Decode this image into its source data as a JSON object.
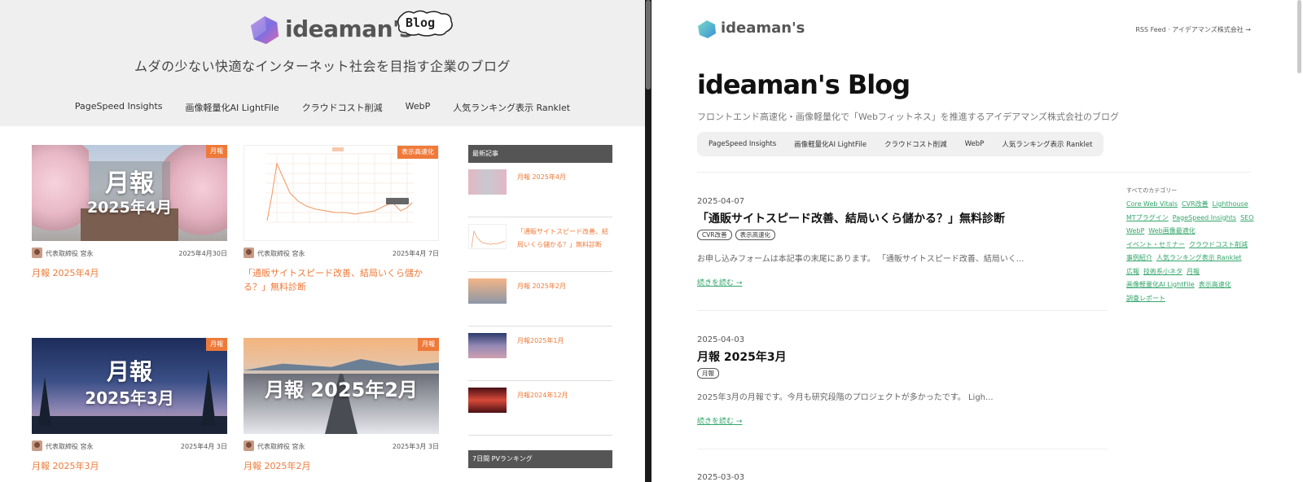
{
  "left": {
    "logo_text": "ideaman's",
    "logo_badge": "Blog",
    "tagline": "ムダの少ない快適なインターネット社会を目指す企業のブログ",
    "nav": [
      "PageSpeed Insights",
      "画像軽量化AI LightFile",
      "クラウドコスト削減",
      "WebP",
      "人気ランキング表示 Ranklet"
    ],
    "cards": [
      {
        "tag": "月報",
        "thumb_line1": "月報",
        "thumb_line2": "2025年4月",
        "author": "代表取締役 宮永",
        "date": "2025年4月30日",
        "title": "月報 2025年4月"
      },
      {
        "tag": "表示高速化",
        "thumb_line1": "",
        "thumb_line2": "",
        "author": "代表取締役 宮永",
        "date": "2025年4月 7日",
        "title": "「通販サイトスピード改善、結局いくら儲かる？」無料診断"
      },
      {
        "tag": "月報",
        "thumb_line1": "月報",
        "thumb_line2": "2025年3月",
        "author": "代表取締役 宮永",
        "date": "2025年4月 3日",
        "title": "月報 2025年3月"
      },
      {
        "tag": "月報",
        "thumb_line1": "月報 2025年2月",
        "thumb_line2": "",
        "author": "代表取締役 宮永",
        "date": "2025年3月 3日",
        "title": "月報 2025年2月"
      }
    ],
    "sidebar": {
      "latest_heading": "最新記事",
      "latest": [
        {
          "title": "月報 2025年4月"
        },
        {
          "title": "「通販サイトスピード改善、結局いくら儲かる？」無料診断"
        },
        {
          "title": "月報 2025年2月"
        },
        {
          "title": "月報2025年1月"
        },
        {
          "title": "月報2024年12月"
        }
      ],
      "ranking_heading": "7日間 PVランキング"
    }
  },
  "right": {
    "logo_text": "ideaman's",
    "toplinks": "RSS Feed · アイデアマンズ株式会社 →",
    "title": "ideaman's Blog",
    "subtitle": "フロントエンド高速化・画像軽量化で「Webフィットネス」を推進するアイデアマンズ株式会社のブログ",
    "nav": [
      "PageSpeed Insights",
      "画像軽量化AI LightFile",
      "クラウドコスト削減",
      "WebP",
      "人気ランキング表示 Ranklet"
    ],
    "posts": [
      {
        "date": "2025-04-07",
        "title": "「通販サイトスピード改善、結局いくら儲かる？」無料診断",
        "tags": [
          "CVR改善",
          "表示高速化"
        ],
        "excerpt": "お申し込みフォームは本記事の末尾にあります。 「通販サイトスピード改善、結局いく...",
        "more": "続きを読む →"
      },
      {
        "date": "2025-04-03",
        "title": "月報 2025年3月",
        "tags": [
          "月報"
        ],
        "excerpt": "2025年3月の月報です。今月も研究段階のプロジェクトが多かったです。 Ligh...",
        "more": "続きを読む →"
      },
      {
        "date": "2025-03-03"
      }
    ],
    "categories_heading": "すべてのカテゴリー",
    "categories": [
      "Core Web Vitals",
      "CVR改善",
      "Lighthouse",
      "MTプラグイン",
      "PageSpeed Insights",
      "SEO",
      "WebP",
      "Web画像最適化",
      "イベント・セミナー",
      "クラウドコスト削減",
      "事例紹介",
      "人気ランキング表示 Ranklet",
      "広報",
      "技術系小ネタ",
      "月報",
      "画像軽量化AI LightFile",
      "表示高速化",
      "調査レポート"
    ]
  },
  "colors": {
    "accent_orange": "#ee7a3a",
    "link_green": "#34a56b",
    "header_gray": "#efefef",
    "sidebar_head": "#555555"
  }
}
